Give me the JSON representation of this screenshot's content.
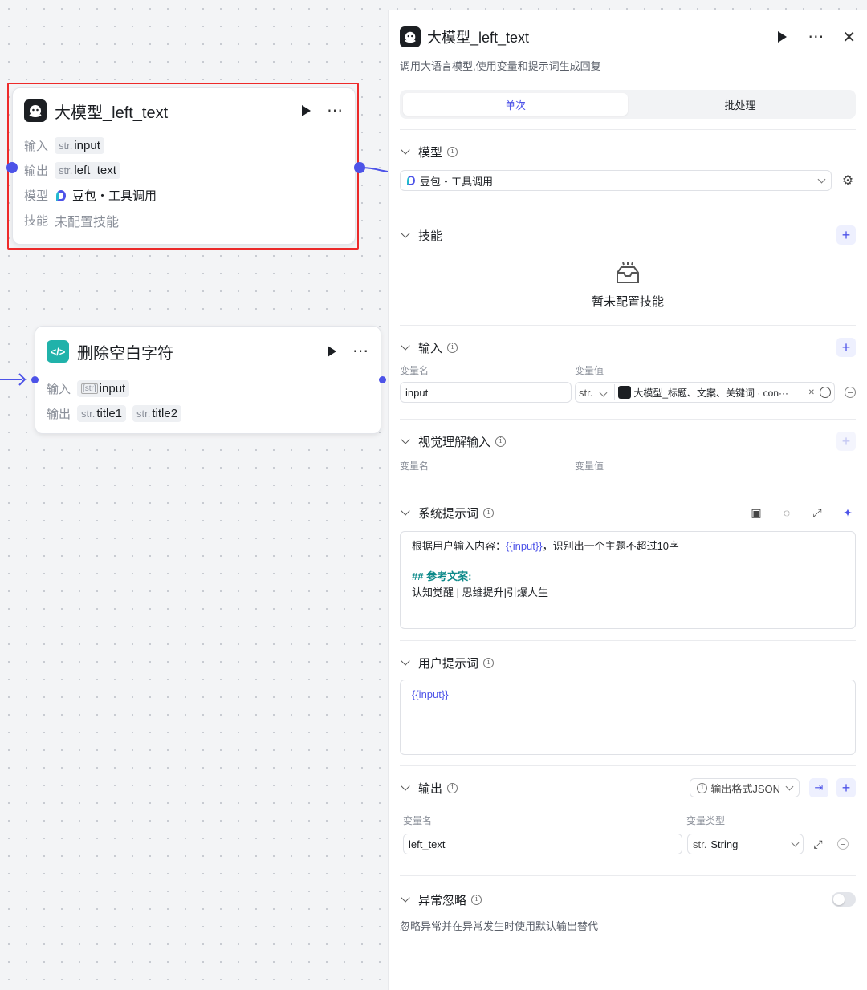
{
  "node_llm": {
    "title": "大模型_left_text",
    "rows": [
      {
        "label": "输入",
        "type": "str.",
        "value": "input"
      },
      {
        "label": "输出",
        "type": "str.",
        "value": "left_text"
      },
      {
        "label": "模型",
        "value": "豆包・工具调用"
      },
      {
        "label": "技能",
        "value": "未配置技能"
      }
    ]
  },
  "node_trim": {
    "title": "删除空白字符",
    "input_label": "输入",
    "input_type": "[str]",
    "input_value": "input",
    "output_label": "输出",
    "outputs": [
      {
        "type": "str.",
        "value": "title1"
      },
      {
        "type": "str.",
        "value": "title2"
      }
    ]
  },
  "panel": {
    "title": "大模型_left_text",
    "description": "调用大语言模型,使用变量和提示词生成回复",
    "tabs": [
      "单次",
      "批处理"
    ],
    "model": {
      "section": "模型",
      "selected": "豆包・工具调用"
    },
    "skills": {
      "section": "技能",
      "empty_text": "暂未配置技能"
    },
    "input": {
      "section": "输入",
      "col_name": "变量名",
      "col_value": "变量值",
      "var_name": "input",
      "var_type": "str.",
      "ref_value": "大模型_标题、文案、关键词 · con···"
    },
    "vision": {
      "section": "视觉理解输入",
      "col_name": "变量名",
      "col_value": "变量值"
    },
    "system_prompt": {
      "section": "系统提示词",
      "line1_prefix": "根据用户输入内容：",
      "line1_var": "{{input}}",
      "line1_suffix": "，识别出一个主题不超过10字",
      "heading": "## 参考文案:",
      "line3": "认知觉醒 | 思维提升|引爆人生"
    },
    "user_prompt": {
      "section": "用户提示词",
      "content": "{{input}}"
    },
    "output": {
      "section": "输出",
      "format_label": "输出格式JSON",
      "col_name": "变量名",
      "col_type": "变量类型",
      "var_name": "left_text",
      "var_type_prefix": "str.",
      "var_type": "String"
    },
    "exception": {
      "section": "异常忽略",
      "description": "忽略异常并在异常发生时使用默认输出替代"
    }
  },
  "colors": {
    "accent": "#4d53e8",
    "highlight_border": "#ee2a2a",
    "trim_icon": "#20b2aa"
  }
}
